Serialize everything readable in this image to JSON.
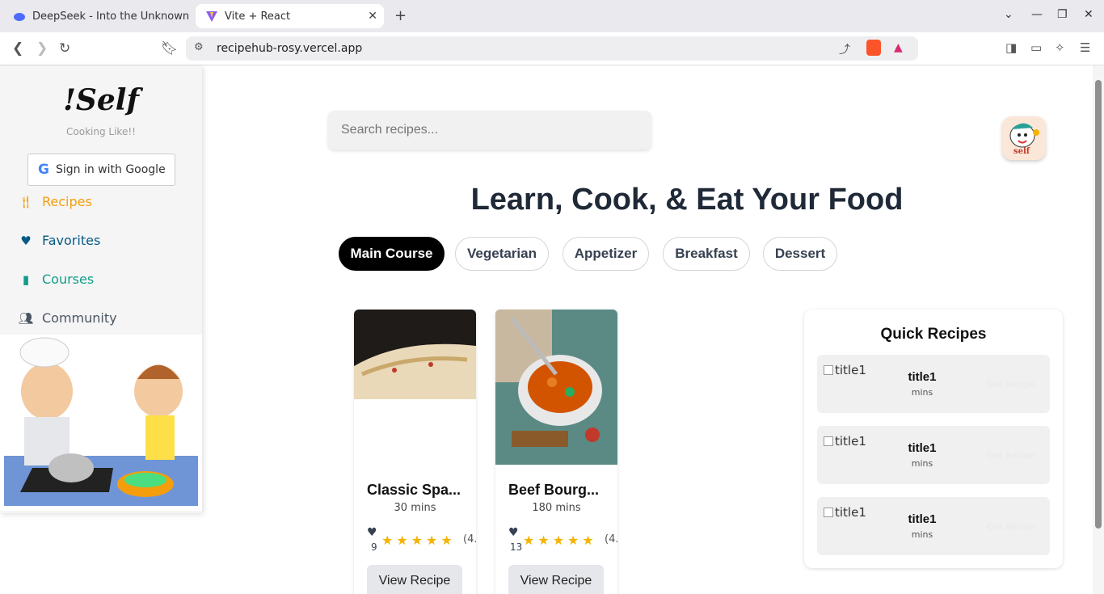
{
  "browser": {
    "tabs": [
      {
        "title": "DeepSeek - Into the Unknown",
        "icon": "deepseek-whale-icon"
      },
      {
        "title": "Vite + React",
        "icon": "vite-icon"
      }
    ],
    "url": "recipehub-rosy.vercel.app"
  },
  "sidebar": {
    "logo": "!Self",
    "tagline": "Cooking Like!!",
    "google_button": "Sign in with Google",
    "items": [
      {
        "label": "Recipes",
        "icon": "utensils-icon",
        "color": "#f59e0b"
      },
      {
        "label": "Favorites",
        "icon": "heart-icon",
        "color": "#075985"
      },
      {
        "label": "Courses",
        "icon": "book-icon",
        "color": "#0f9d8a"
      },
      {
        "label": "Community",
        "icon": "users-icon",
        "color": "#4b5563"
      }
    ]
  },
  "main": {
    "search_placeholder": "Search recipes...",
    "headline": "Learn, Cook, & Eat Your Food",
    "categories": [
      "Main Course",
      "Vegetarian",
      "Appetizer",
      "Breakfast",
      "Dessert"
    ],
    "active_category": "Main Course",
    "recipes": [
      {
        "title": "Classic Spa...",
        "time": "30 mins",
        "likes": "9",
        "rating": "(4.",
        "button": "View Recipe"
      },
      {
        "title": "Beef Bourg...",
        "time": "180 mins",
        "likes": "13",
        "rating": "(4.",
        "button": "View Recipe"
      }
    ],
    "quick": {
      "title": "Quick Recipes",
      "items": [
        {
          "alt": "title1",
          "name": "title1",
          "time": "mins",
          "button": "Get Recipe"
        },
        {
          "alt": "title1",
          "name": "title1",
          "time": "mins",
          "button": "Get Recipe"
        },
        {
          "alt": "title1",
          "name": "title1",
          "time": "mins",
          "button": "Get Recipe"
        }
      ]
    }
  },
  "colors": {
    "accent": "#f59e0b",
    "star": "#f5b301"
  }
}
